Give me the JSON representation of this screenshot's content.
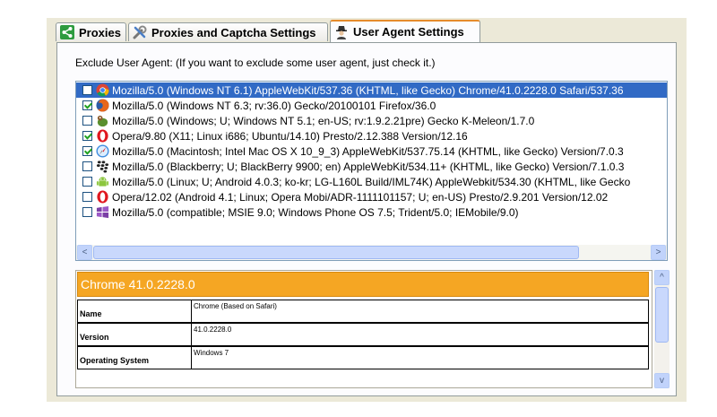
{
  "tabs": [
    {
      "label": "Proxies",
      "icon": "share-icon"
    },
    {
      "label": "Proxies and Captcha Settings",
      "icon": "tools-icon"
    },
    {
      "label": "User Agent Settings",
      "icon": "agent-icon"
    }
  ],
  "caption": "Exclude User Agent: (If you want to exclude some user agent, just check it.)",
  "agents": [
    {
      "text": "Mozilla/5.0 (Windows NT 6.1) AppleWebKit/537.36 (KHTML, like Gecko) Chrome/41.0.2228.0 Safari/537.36",
      "checked": false,
      "selected": true,
      "icon": "chrome-icon"
    },
    {
      "text": "Mozilla/5.0 (Windows NT 6.3; rv:36.0) Gecko/20100101 Firefox/36.0",
      "checked": true,
      "selected": false,
      "icon": "firefox-icon"
    },
    {
      "text": "Mozilla/5.0 (Windows; U; Windows NT 5.1; en-US; rv:1.9.2.21pre) Gecko K-Meleon/1.7.0",
      "checked": false,
      "selected": false,
      "icon": "kmeleon-icon"
    },
    {
      "text": "Opera/9.80 (X11; Linux i686; Ubuntu/14.10) Presto/2.12.388 Version/12.16",
      "checked": true,
      "selected": false,
      "icon": "opera-icon"
    },
    {
      "text": "Mozilla/5.0 (Macintosh; Intel Mac OS X 10_9_3) AppleWebKit/537.75.14 (KHTML, like Gecko) Version/7.0.3",
      "checked": true,
      "selected": false,
      "icon": "safari-icon"
    },
    {
      "text": "Mozilla/5.0 (Blackberry; U; BlackBerry 9900; en) AppleWebKit/534.11+ (KHTML, like Gecko) Version/7.1.0.3",
      "checked": false,
      "selected": false,
      "icon": "blackberry-icon"
    },
    {
      "text": "Mozilla/5.0 (Linux; U; Android 4.0.3; ko-kr; LG-L160L Build/IML74K) AppleWebkit/534.30 (KHTML, like Gecko",
      "checked": false,
      "selected": false,
      "icon": "android-icon"
    },
    {
      "text": "Opera/12.02 (Android 4.1; Linux; Opera Mobi/ADR-1111101157; U; en-US) Presto/2.9.201 Version/12.02",
      "checked": false,
      "selected": false,
      "icon": "opera-icon"
    },
    {
      "text": "Mozilla/5.0 (compatible; MSIE 9.0; Windows Phone OS 7.5; Trident/5.0; IEMobile/9.0)",
      "checked": false,
      "selected": false,
      "icon": "windows-icon"
    }
  ],
  "details": {
    "title": "Chrome 41.0.2228.0",
    "rows": [
      {
        "label": "Name",
        "value": "Chrome (Based on Safari)"
      },
      {
        "label": "Version",
        "value": "41.0.2228.0"
      },
      {
        "label": "Operating System",
        "value": "Windows 7"
      }
    ]
  },
  "scroll": {
    "left_arrow": "<",
    "right_arrow": ">",
    "up_arrow": "^",
    "down_arrow": "v"
  },
  "colors": {
    "accent": "#F5A623",
    "selection": "#316AC5",
    "tab_highlight": "#E68B2C"
  }
}
